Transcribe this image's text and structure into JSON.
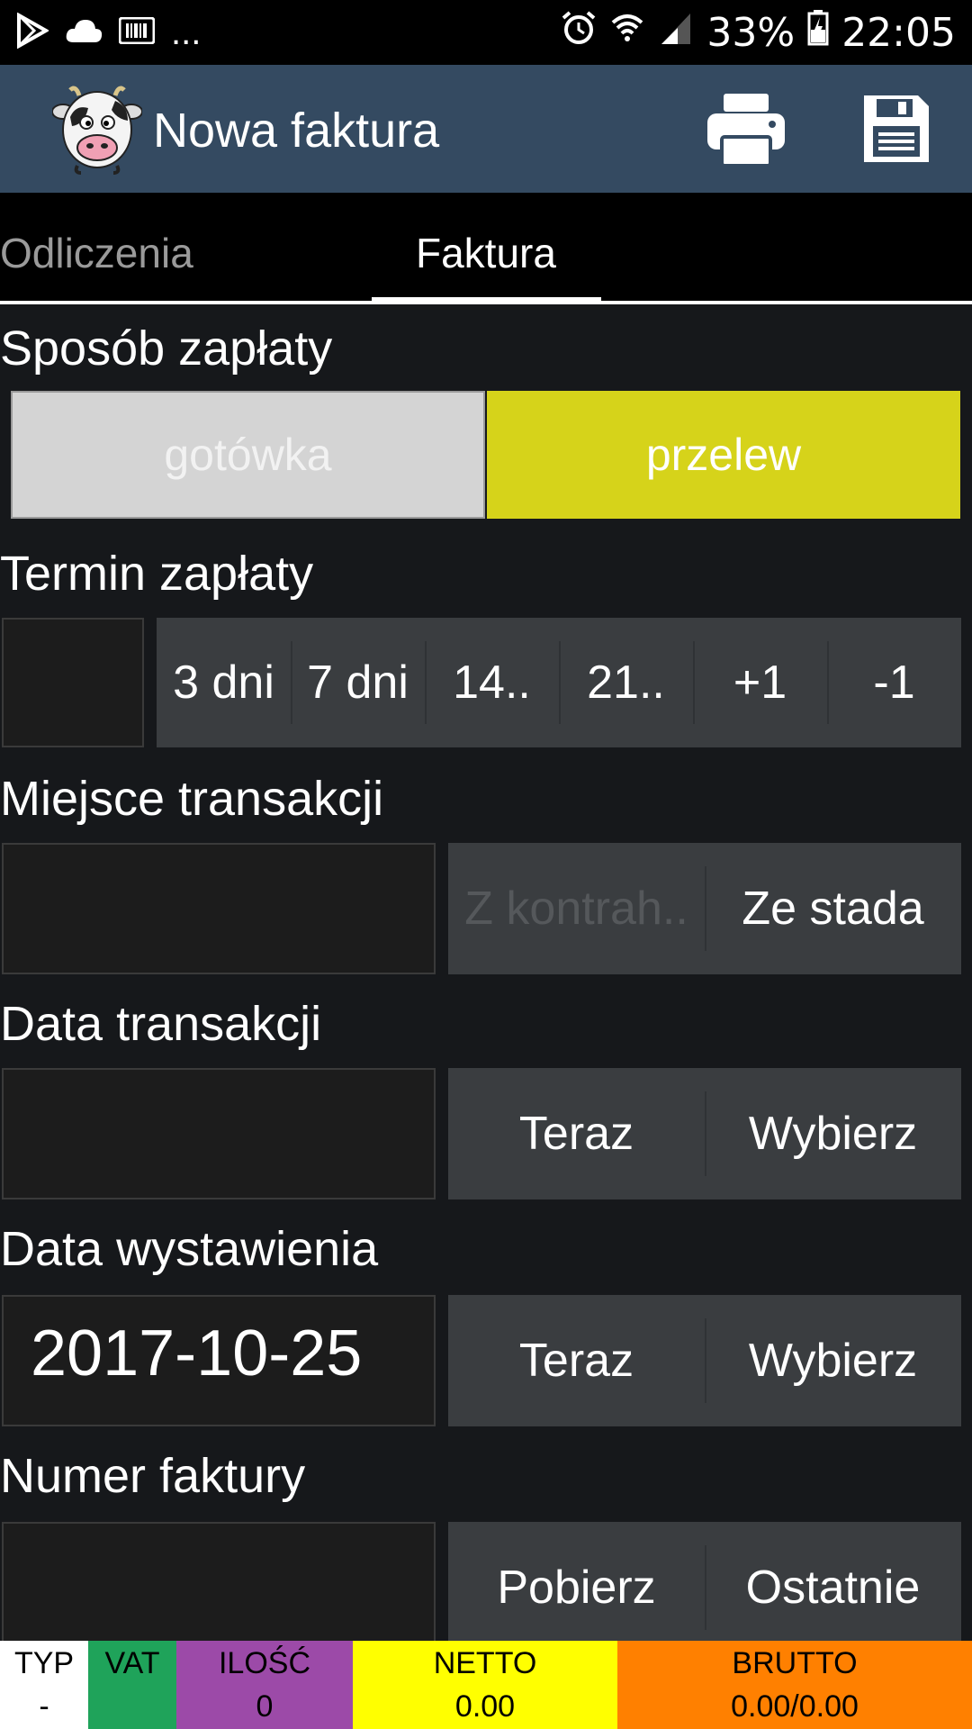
{
  "status_bar": {
    "battery": "33%",
    "time": "22:05",
    "ellipsis": "..."
  },
  "app_bar": {
    "title": "Nowa faktura"
  },
  "tabs": [
    {
      "label": "Odliczenia",
      "active": false
    },
    {
      "label": "Faktura",
      "active": true
    }
  ],
  "payment_method": {
    "label": "Sposób zapłaty",
    "options": [
      "gotówka",
      "przelew"
    ],
    "selected": "przelew"
  },
  "payment_term": {
    "label": "Termin zapłaty",
    "value": "",
    "buttons": [
      "3 dni",
      "7 dni",
      "14..",
      "21..",
      "+1",
      "-1"
    ]
  },
  "transaction_place": {
    "label": "Miejsce transakcji",
    "value": "",
    "buttons": [
      "Z kontrah..",
      "Ze stada"
    ]
  },
  "transaction_date": {
    "label": "Data transakcji",
    "value": "",
    "buttons": [
      "Teraz",
      "Wybierz"
    ]
  },
  "issue_date": {
    "label": "Data wystawienia",
    "value": "2017-10-25",
    "buttons": [
      "Teraz",
      "Wybierz"
    ]
  },
  "invoice_number": {
    "label": "Numer faktury",
    "value": "",
    "buttons": [
      "Pobierz",
      "Ostatnie"
    ]
  },
  "summary": {
    "typ": {
      "label": "TYP",
      "value": "-",
      "color": "#ffffff"
    },
    "vat": {
      "label": "VAT",
      "value": "",
      "color": "#1fa35a"
    },
    "ilosc": {
      "label": "ILOŚĆ",
      "value": "0",
      "color": "#9c4aa8"
    },
    "netto": {
      "label": "NETTO",
      "value": "0.00",
      "color": "#ffff00"
    },
    "brutto": {
      "label": "BRUTTO",
      "value": "0.00/0.00",
      "color": "#ff8000"
    }
  },
  "colors": {
    "app_bar": "#344a61",
    "selected_segment": "#d6d31a",
    "unselected_segment": "#d4d4d4"
  }
}
